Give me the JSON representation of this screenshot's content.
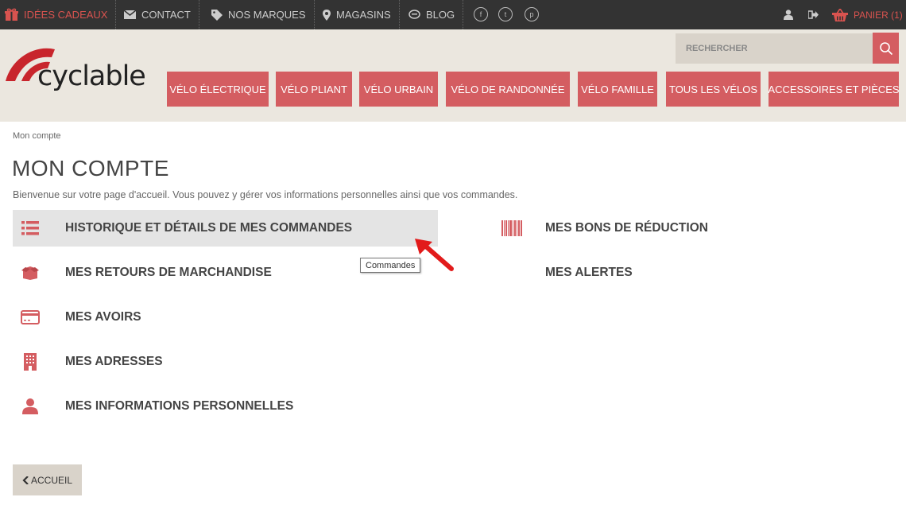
{
  "topbar": {
    "gift_ideas": "IDÉES CADEAUX",
    "contact": "CONTACT",
    "brands": "NOS MARQUES",
    "stores": "MAGASINS",
    "blog": "BLOG",
    "social_facebook": "f",
    "social_twitter": "t",
    "social_pinterest": "p",
    "cart": "PANIER (1)"
  },
  "header": {
    "brand": "cyclable",
    "search_placeholder": "RECHERCHER",
    "nav": [
      "VÉLO ÉLECTRIQUE",
      "VÉLO PLIANT",
      "VÉLO URBAIN",
      "VÉLO DE RANDONNÉE",
      "VÉLO FAMILLE",
      "TOUS LES VÉLOS",
      "ACCESSOIRES ET PIÈCES"
    ]
  },
  "page": {
    "breadcrumb": "Mon compte",
    "title": "MON COMPTE",
    "intro": "Bienvenue sur votre page d'accueil. Vous pouvez y gérer vos informations personnelles ainsi que vos commandes."
  },
  "account_links": {
    "orders": "HISTORIQUE ET DÉTAILS DE MES COMMANDES",
    "returns": "MES RETOURS DE MARCHANDISE",
    "credits": "MES AVOIRS",
    "addresses": "MES ADRESSES",
    "personal_info": "MES INFORMATIONS PERSONNELLES",
    "vouchers": "MES BONS DE RÉDUCTION",
    "alerts": "MES ALERTES"
  },
  "tooltip": "Commandes",
  "back_button": "ACCUEIL",
  "colors": {
    "accent": "#d45d61",
    "topbar": "#333333",
    "header_bg": "#ebe7df"
  }
}
